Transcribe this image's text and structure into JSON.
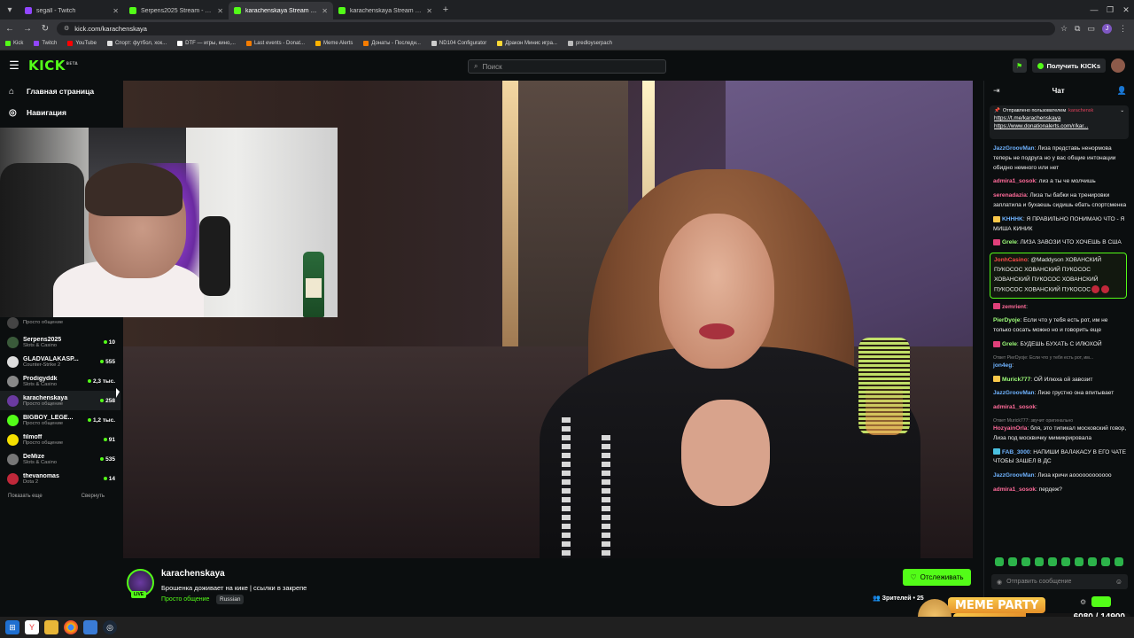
{
  "browser": {
    "tabs": [
      {
        "label": "segall - Twitch",
        "color": "#9146ff",
        "active": false
      },
      {
        "label": "Serpens2025 Stream - Watch Liv",
        "color": "#53fc18",
        "active": false
      },
      {
        "label": "karachenskaya Stream - Watch",
        "color": "#53fc18",
        "active": true
      },
      {
        "label": "karachenskaya Stream - Watch",
        "color": "#53fc18",
        "active": false
      }
    ],
    "url": "kick.com/karachenskaya",
    "profile_initial": "J",
    "bookmarks": [
      {
        "label": "Kick",
        "color": "#53fc18"
      },
      {
        "label": "Twitch",
        "color": "#9146ff"
      },
      {
        "label": "YouTube",
        "color": "#ff0000"
      },
      {
        "label": "Спорт: футбол, хок...",
        "color": "#e0e0e0"
      },
      {
        "label": "DTF — игры, кино,...",
        "color": "#ffffff"
      },
      {
        "label": "Last events - Donat...",
        "color": "#f57c00"
      },
      {
        "label": "Meme Alerts",
        "color": "#ffb300"
      },
      {
        "label": "Донаты - Последн...",
        "color": "#f57c00"
      },
      {
        "label": "ND104 Configurator",
        "color": "#cccccc"
      },
      {
        "label": "Дракон Минис игра...",
        "color": "#fdd835"
      },
      {
        "label": "predloyserpach",
        "color": "#bbbbbb"
      }
    ]
  },
  "header": {
    "logo": "KICK",
    "logo_badge": "BETA",
    "search_placeholder": "Поиск",
    "kicks_button": "Получить KICKs"
  },
  "sidebar": {
    "nav": [
      {
        "label": "Главная страница",
        "icon": "home-icon"
      },
      {
        "label": "Навигация",
        "icon": "compass-icon"
      }
    ],
    "channels": [
      {
        "name": "",
        "category": "Просто общение",
        "viewers": "",
        "color": "#444"
      },
      {
        "name": "Serpens2025",
        "category": "Slots & Casino",
        "viewers": "10",
        "color": "#3a5a3a"
      },
      {
        "name": "GLADVALAKASP...",
        "category": "Counter-Strike 2",
        "viewers": "555",
        "color": "#dddddd"
      },
      {
        "name": "Prodigyddk",
        "category": "Slots & Casino",
        "viewers": "2,3 тыс.",
        "color": "#888888"
      },
      {
        "name": "karachenskaya",
        "category": "Просто общение",
        "viewers": "258",
        "color": "#6a3aa0",
        "selected": true
      },
      {
        "name": "BIGBOY_LEGE...",
        "category": "Просто общение",
        "viewers": "1,2 тыс.",
        "color": "#53fc18"
      },
      {
        "name": "filmoff",
        "category": "Просто общение",
        "viewers": "91",
        "color": "#f5e000"
      },
      {
        "name": "DeMize",
        "category": "Slots & Casino",
        "viewers": "535",
        "color": "#777777"
      },
      {
        "name": "thevanomas",
        "category": "Dota 2",
        "viewers": "14",
        "color": "#c0283a"
      }
    ],
    "show_more": "Показать еще",
    "collapse": "Свернуть"
  },
  "stream": {
    "streamer": "karachenskaya",
    "title": "Брошенка доживает на кике | ссылки в закрепе",
    "category": "Просто общение",
    "tag": "Russian",
    "live_label": "LIVE",
    "follow_button": "Отслеживать",
    "viewers_label": "Зрителей • 25"
  },
  "chat": {
    "title": "Чат",
    "pinned": {
      "header": "Отправлено пользователем",
      "user": "karachensk",
      "links": [
        "https://t.me/karachenskaya",
        "https://www.donationalerts.com/r/kar..."
      ]
    },
    "messages": [
      {
        "user": "JazzGroovMan",
        "color": "#6fb3ff",
        "text": ": Лиза представь ненормова теперь не подруга но у вас общие интонации обидно немного или нет"
      },
      {
        "user": "admira1_sosok",
        "color": "#ff6b9a",
        "text": ": лиз а ты че молчишь"
      },
      {
        "user": "serenadazia",
        "color": "#ff6b9a",
        "text": ": Лиза ты бабки на тренировки заплатила и бухаешь сидишь ебать спортсменка"
      },
      {
        "user": "KHHHK",
        "color": "#6fb3ff",
        "text": ": Я ПРАВИЛЬНО ПОНИМАЮ ЧТО - Я МИША КИНИК",
        "badge": "#f9c84a"
      },
      {
        "user": "Grele",
        "color": "#9fff7a",
        "text": ": ЛИЗА ЗАВОЗИ ЧТО ХОЧЕШЬ В США",
        "badge": "#e0407a"
      },
      {
        "user": "JonhCasino",
        "color": "#ff4a4a",
        "text": ": @Maddyson ХОВАНСКИЙ ПУКОСОС ХОВАНСКИЙ ПУКОСОС ХОВАНСКИЙ ПУКОСОС ХОВАНСКИЙ ПУКОСОС ХОВАНСКИЙ ПУКОСОС",
        "highlight": true
      },
      {
        "user": "zemrient",
        "color": "#ff6b9a",
        "text": ":",
        "badge": "#e0407a"
      },
      {
        "user": "PierDyoje",
        "color": "#9fff7a",
        "text": ": Если что у тебя есть рот, им не только сосать можно но и говорить еще"
      },
      {
        "user": "Grele",
        "color": "#9fff7a",
        "text": ": БУДЕШЬ БУХАТЬ С ИЛЮХОЙ",
        "badge": "#e0407a"
      },
      {
        "user": "jon4eg",
        "color": "#6fb3ff",
        "text": ":",
        "reply": "Ответ PierDyoje: Если что у тебя есть рот, им..."
      },
      {
        "user": "Murick777",
        "color": "#9fff7a",
        "text": ": ОЙ Илюха ой завозит",
        "badge": "#f9c84a"
      },
      {
        "user": "JazzGroovMan",
        "color": "#6fb3ff",
        "text": ": Лизе грустно она впитывает"
      },
      {
        "user": "admira1_sosok",
        "color": "#ff6b9a",
        "text": ":"
      },
      {
        "user": "HozyainOrla",
        "color": "#ff6b9a",
        "text": ": бля, это типикал московский говор, Лиза под москвичку мимикрировала",
        "reply": "Ответ Murick777: звучит оригинально"
      },
      {
        "user": "FAB_3000",
        "color": "#6fb3ff",
        "text": ": НАПИШИ ВАЛАКАСУ В ЕГО ЧАТЕ ЧТОБЫ ЗАШЕЛ В ДС",
        "badge": "#4ac0e0"
      },
      {
        "user": "JazzGroovMan",
        "color": "#6fb3ff",
        "text": ": Лиза кричи аоооооооооооо"
      },
      {
        "user": "admira1_sosok",
        "color": "#ff6b9a",
        "text": ": пердеж?"
      }
    ],
    "input_placeholder": "Отправить сообщение"
  },
  "overlay": {
    "meme_title": "MEME PARTY",
    "progress_text": "6080 / 14900",
    "progress_fraction": 0.408
  }
}
